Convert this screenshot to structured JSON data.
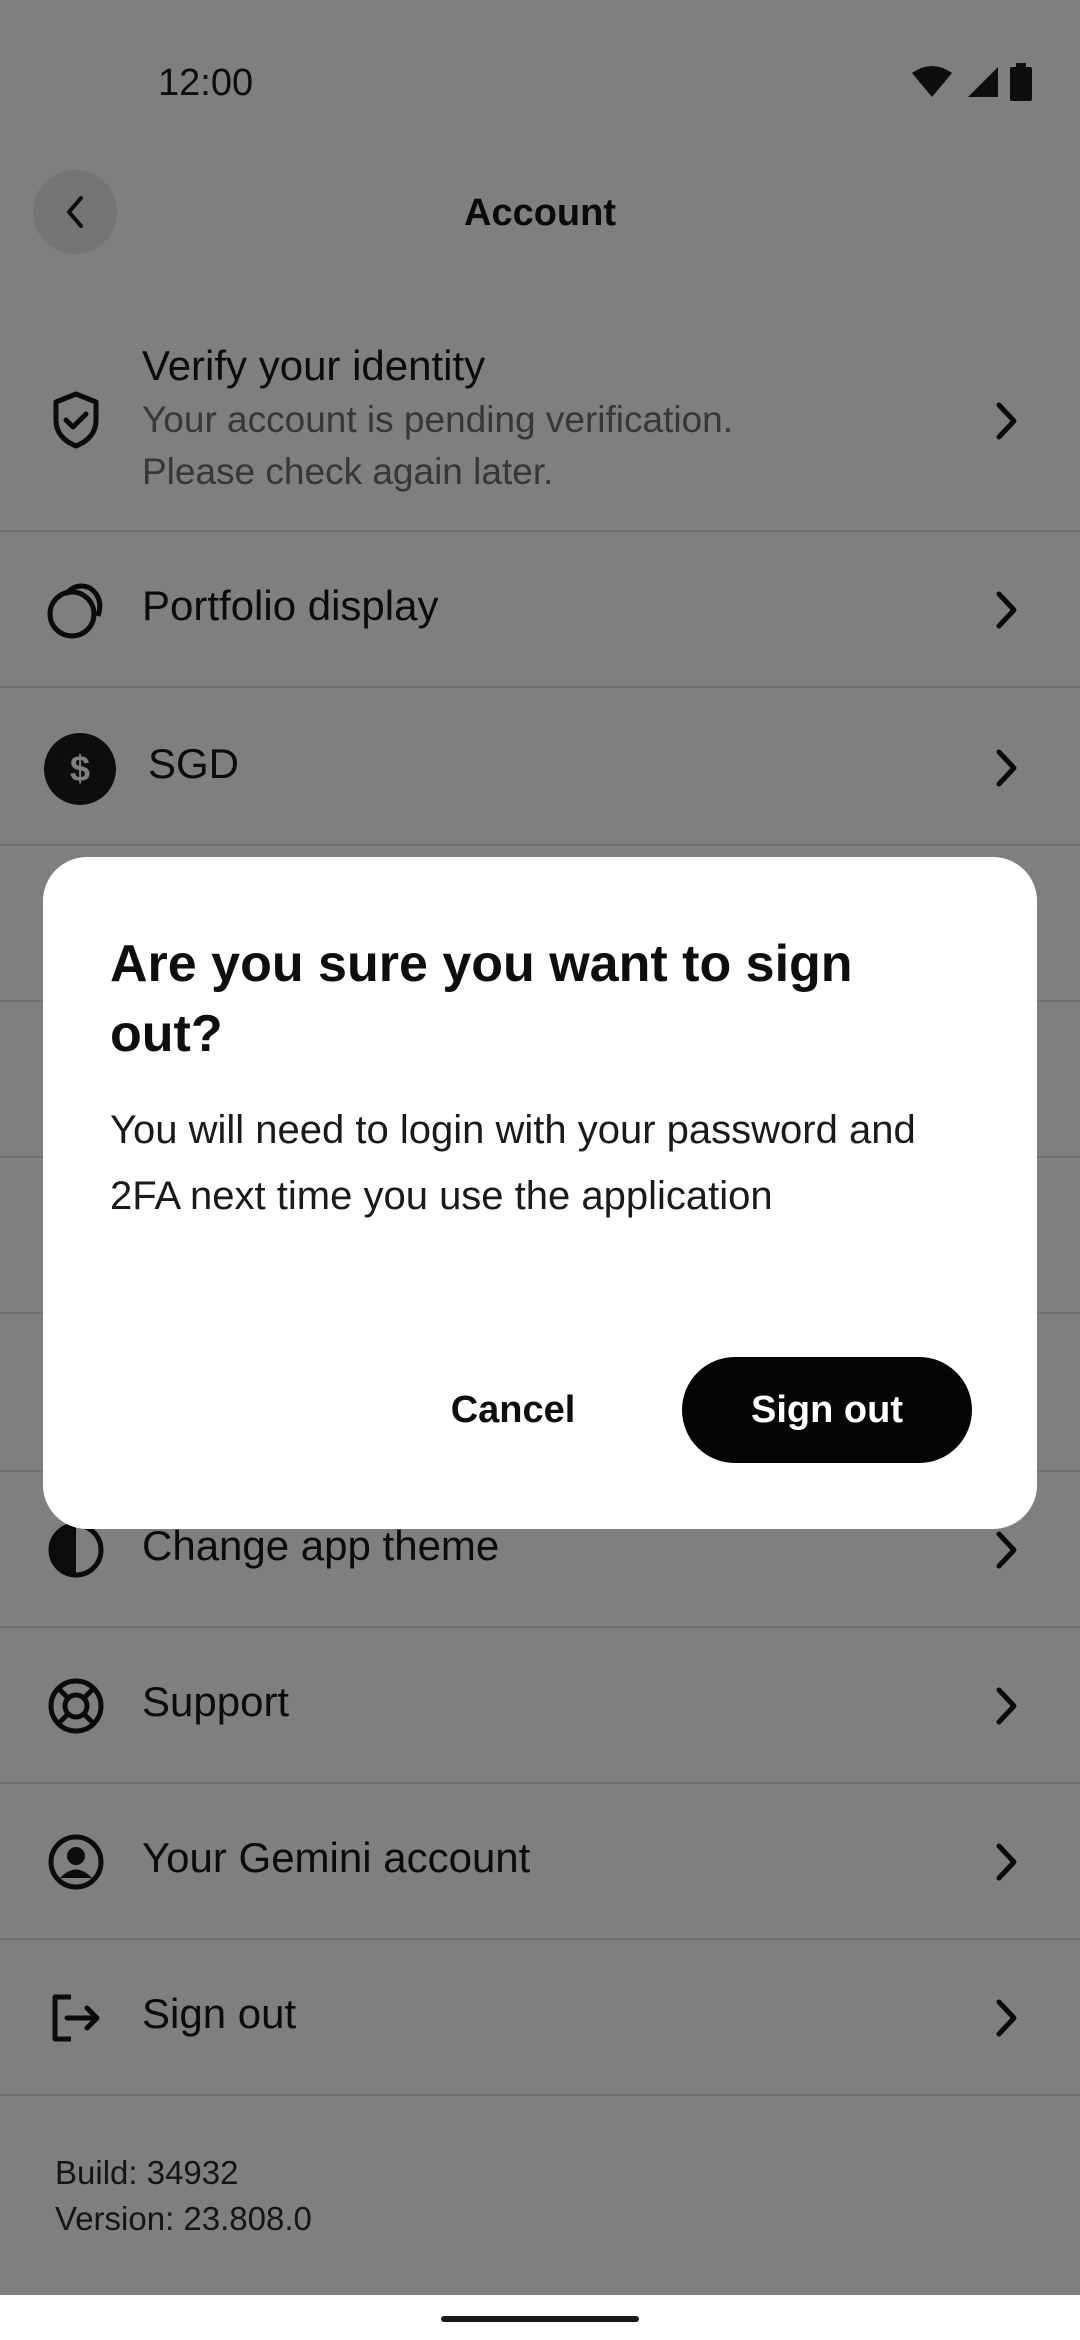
{
  "status_bar": {
    "time": "12:00"
  },
  "header": {
    "title": "Account"
  },
  "list": {
    "verify": {
      "label": "Verify your identity",
      "sub_line1": "Your account is pending verification.",
      "sub_line2": "Please check again later."
    },
    "portfolio": {
      "label": "Portfolio display"
    },
    "currency": {
      "label": "SGD",
      "symbol": "$"
    },
    "theme": {
      "label": "Change app theme"
    },
    "support": {
      "label": "Support"
    },
    "gemini": {
      "label": "Your Gemini account"
    },
    "signout": {
      "label": "Sign out"
    }
  },
  "footer": {
    "build": "Build: 34932",
    "version": "Version: 23.808.0"
  },
  "dialog": {
    "title": "Are you sure you want to sign out?",
    "body": "You will need to login with your password and 2FA next time you use the application",
    "cancel_label": "Cancel",
    "confirm_label": "Sign out"
  },
  "icons": {
    "back": "chevron-left-icon",
    "verify": "shield-check-icon",
    "portfolio": "portfolio-circles-icon",
    "currency": "dollar-coin-icon",
    "theme": "half-circle-icon",
    "support": "lifebuoy-icon",
    "gemini": "user-circle-icon",
    "signout": "logout-icon",
    "row_arrow": "chevron-right-icon"
  },
  "colors": {
    "scrim": "rgba(0,0,0,0.5)",
    "primary_button": "#050505",
    "divider": "#e2e2e2"
  }
}
